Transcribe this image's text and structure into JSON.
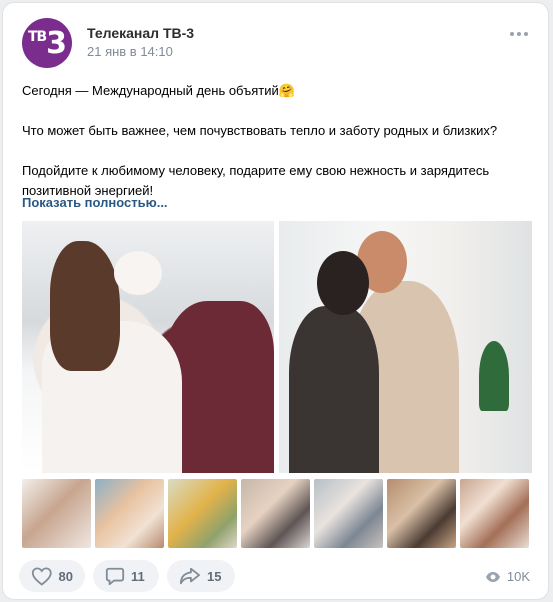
{
  "post": {
    "author": "Телеканал ТВ-3",
    "date": "21 янв в 14:10",
    "avatar_text_small": "ТВ",
    "avatar_text_big": "3",
    "lines": [
      "Сегодня — Международный день объятий🤗",
      "Что может быть важнее, чем почувствовать тепло и заботу родных и близких?",
      "Подойдите к любимому человеку, подарите ему свою нежность и зарядитесь позитивной энергией!"
    ],
    "show_more": "Показать полностью..."
  },
  "actions": {
    "likes": "80",
    "comments": "11",
    "shares": "15",
    "views": "10K"
  },
  "colors": {
    "brand": "#7b2d8e",
    "link": "#2a5885",
    "muted": "#818c99"
  },
  "icons": [
    "more-icon",
    "heart-icon",
    "comment-icon",
    "share-icon",
    "eye-icon"
  ]
}
